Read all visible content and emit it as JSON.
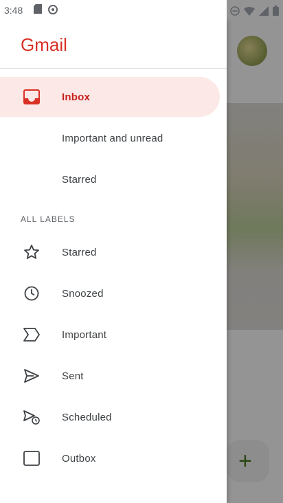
{
  "status_bar": {
    "time": "3:48"
  },
  "drawer": {
    "logo_text": "Gmail",
    "items": [
      {
        "label": "Inbox",
        "icon": "inbox-icon",
        "active": true
      },
      {
        "label": "Important and unread",
        "icon": "",
        "active": false
      },
      {
        "label": "Starred",
        "icon": "",
        "active": false
      }
    ],
    "section_label": "ALL LABELS",
    "labels": [
      {
        "label": "Starred",
        "icon": "star-icon"
      },
      {
        "label": "Snoozed",
        "icon": "clock-icon"
      },
      {
        "label": "Important",
        "icon": "important-icon"
      },
      {
        "label": "Sent",
        "icon": "send-icon"
      },
      {
        "label": "Scheduled",
        "icon": "scheduled-send-icon"
      },
      {
        "label": "Outbox",
        "icon": "outbox-icon"
      }
    ]
  },
  "colors": {
    "accent": "#d93025",
    "active_bg": "#fce8e6",
    "text": "#3c4043"
  }
}
